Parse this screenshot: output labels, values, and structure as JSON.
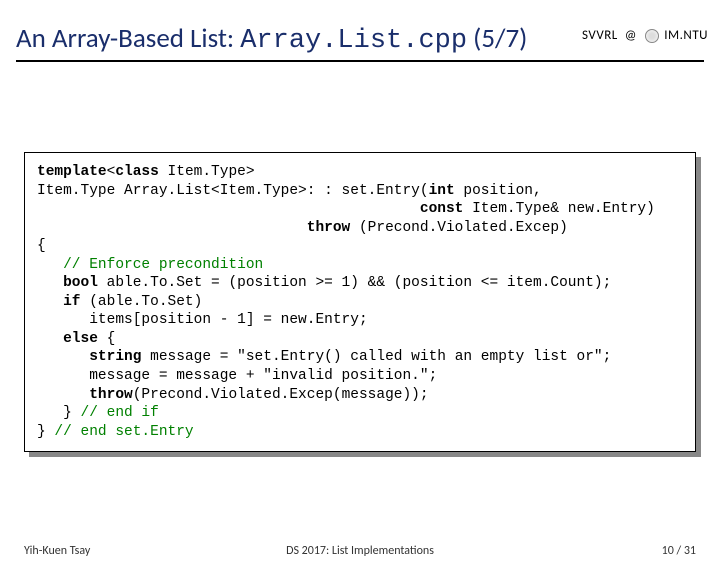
{
  "header": {
    "left": "SVVRL",
    "at": "@",
    "right": "IM.NTU"
  },
  "title": {
    "prefix": "An Array-Based List: ",
    "mono": "Array.List.cpp",
    "suffix": " (5/7)"
  },
  "code": {
    "l1a": "template",
    "l1b": "<",
    "l1c": "class",
    "l1d": " Item.Type>",
    "l2a": "Item.Type Array.List<Item.Type>: : set.Entry(",
    "l2b": "int",
    "l2c": " position,",
    "l3a": "                                            ",
    "l3b": "const",
    "l3c": " Item.Type& new.Entry)",
    "l4a": "                               ",
    "l4b": "throw",
    "l4c": " (Precond.Violated.Excep)",
    "l5": "{",
    "l6a": "   ",
    "l6b": "// Enforce precondition",
    "l7a": "   ",
    "l7b": "bool",
    "l7c": " able.To.Set = (position >= 1) && (position <= item.Count);",
    "l8a": "   ",
    "l8b": "if",
    "l8c": " (able.To.Set)",
    "l9": "      items[position - 1] = new.Entry;",
    "l10a": "   ",
    "l10b": "else",
    "l10c": " {",
    "l11a": "      ",
    "l11b": "string",
    "l11c": " message = \"set.Entry() called with an empty list or\";",
    "l12": "      message = message + \"invalid position.\";",
    "l13a": "      ",
    "l13b": "throw",
    "l13c": "(Precond.Violated.Excep(message));",
    "l14a": "   } ",
    "l14b": "// end if",
    "l15a": "} ",
    "l15b": "// end set.Entry"
  },
  "footer": {
    "author": "Yih-Kuen Tsay",
    "course": "DS 2017: List Implementations",
    "page": "10 / 31"
  }
}
